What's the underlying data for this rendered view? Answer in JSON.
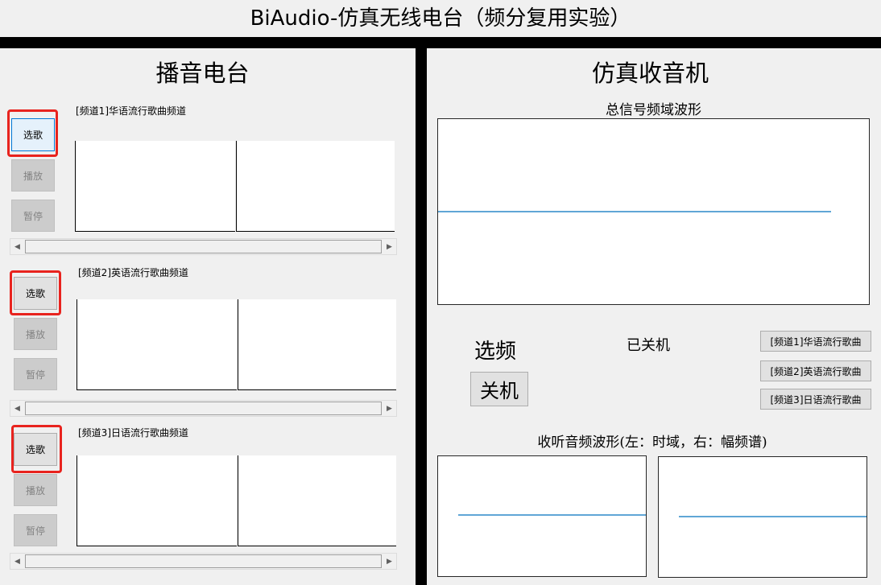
{
  "window": {
    "title": "BiAudio-仿真无线电台（频分复用实验）"
  },
  "broadcast": {
    "title": "播音电台",
    "channels": [
      {
        "label": "[频道1]华语流行歌曲频道",
        "select": "选歌",
        "play": "播放",
        "pause": "暂停"
      },
      {
        "label": "[频道2]英语流行歌曲频道",
        "select": "选歌",
        "play": "播放",
        "pause": "暂停"
      },
      {
        "label": "[频道3]日语流行歌曲频道",
        "select": "选歌",
        "play": "播放",
        "pause": "暂停"
      }
    ]
  },
  "receiver": {
    "title": "仿真收音机",
    "spectrum_title": "总信号频域波形",
    "tune_label": "选频",
    "power_button": "关机",
    "status": "已关机",
    "channel_buttons": [
      "[频道1]华语流行歌曲",
      "[频道2]英语流行歌曲",
      "[频道3]日语流行歌曲"
    ],
    "listen_title": "收听音频波形(左：时域，右：幅频谱)"
  },
  "colors": {
    "line": "#0072bd",
    "highlight": "#e8231e",
    "divider": "#000000"
  },
  "icons": {
    "scroll_left": "triangle-left-icon",
    "scroll_right": "triangle-right-icon"
  }
}
